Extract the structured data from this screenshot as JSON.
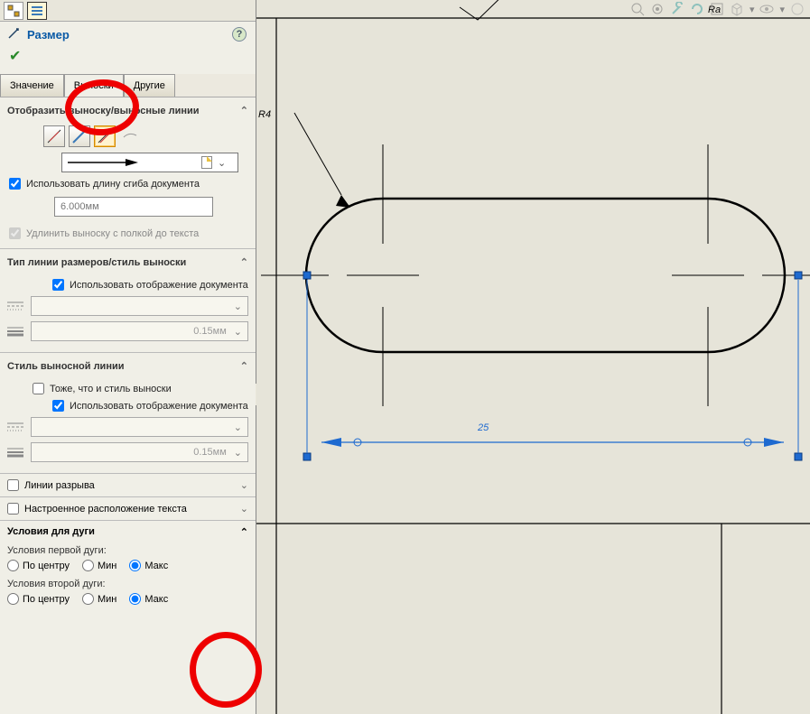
{
  "header": {
    "title": "Размер"
  },
  "tabs": {
    "value": "Значение",
    "leaders": "Выноски",
    "other": "Другие"
  },
  "display_leaders": {
    "title": "Отобразить выноску/выносные линии",
    "use_doc_bend_length": "Использовать длину сгиба документа",
    "bend_length_value": "6.000мм",
    "extend_leader": "Удлинить выноску с полкой до текста"
  },
  "dim_line_style": {
    "title": "Тип линии размеров/стиль выноски",
    "use_doc_display": "Использовать отображение документа",
    "thickness_placeholder": "0.15мм"
  },
  "ext_line_style": {
    "title": "Стиль выносной линии",
    "same_as_leader": "Тоже, что и стиль выноски",
    "use_doc_display": "Использовать отображение документа",
    "thickness_placeholder": "0.15мм"
  },
  "break_lines": "Линии разрыва",
  "custom_text_pos": "Настроенное расположение текста",
  "arc": {
    "title": "Условия для дуги",
    "first_label": "Условия первой дуги:",
    "second_label": "Условия второй дуги:",
    "center": "По центру",
    "min": "Мин",
    "max": "Макс"
  },
  "canvas": {
    "radius_label": "R4",
    "top_right_text": "Ra",
    "dimension": "25"
  }
}
